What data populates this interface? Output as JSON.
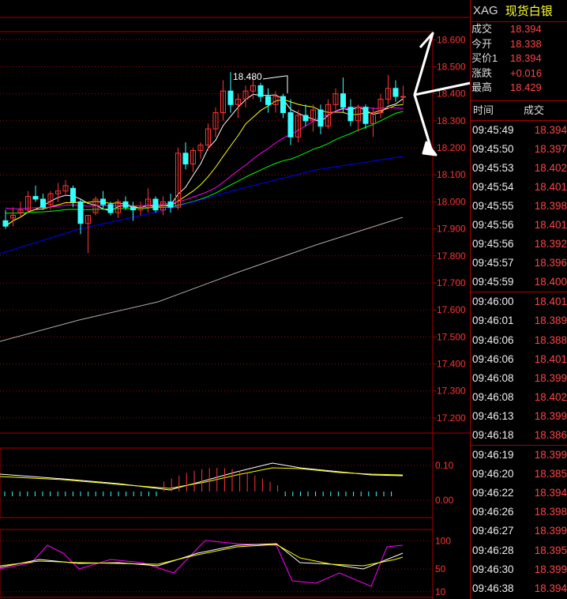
{
  "header": {
    "symbol": "XAG",
    "name": "现货白银"
  },
  "quote": [
    {
      "label": "成交",
      "value": "18.394"
    },
    {
      "label": "今开",
      "value": "18.338"
    },
    {
      "label": "买价1",
      "value": "18.394"
    },
    {
      "label": "涨跌",
      "value": "+0.016"
    },
    {
      "label": "最高",
      "value": "18.429"
    }
  ],
  "ticks_header": {
    "time": "时间",
    "price": "成交"
  },
  "ticks": [
    {
      "time": "09:45:49",
      "price": "18.394"
    },
    {
      "time": "09:45:50",
      "price": "18.397"
    },
    {
      "time": "09:45:53",
      "price": "18.402"
    },
    {
      "time": "09:45:54",
      "price": "18.401"
    },
    {
      "time": "09:45:55",
      "price": "18.398"
    },
    {
      "time": "09:45:56",
      "price": "18.401"
    },
    {
      "time": "09:45:56",
      "price": "18.392"
    },
    {
      "time": "09:45:57",
      "price": "18.396"
    },
    {
      "time": "09:45:59",
      "price": "18.400"
    },
    {
      "time": "09:46:00",
      "price": "18.401"
    },
    {
      "time": "09:46:01",
      "price": "18.389"
    },
    {
      "time": "09:46:06",
      "price": "18.388"
    },
    {
      "time": "09:46:06",
      "price": "18.401"
    },
    {
      "time": "09:46:08",
      "price": "18.399"
    },
    {
      "time": "09:46:08",
      "price": "18.402"
    },
    {
      "time": "09:46:13",
      "price": "18.399"
    },
    {
      "time": "09:46:18",
      "price": "18.386"
    },
    {
      "time": "09:46:19",
      "price": "18.399"
    },
    {
      "time": "09:46:20",
      "price": "18.385"
    },
    {
      "time": "09:46:22",
      "price": "18.394"
    },
    {
      "time": "09:46:26",
      "price": "18.398"
    },
    {
      "time": "09:46:27",
      "price": "18.399"
    },
    {
      "time": "09:46:28",
      "price": "18.395"
    },
    {
      "time": "09:46:30",
      "price": "18.399"
    },
    {
      "time": "09:46:38",
      "price": "18.394"
    }
  ],
  "colors": {
    "up": "#ff3333",
    "down": "#33ffff",
    "grid": "#aa0000",
    "ma5": "#ffffff",
    "ma10": "#ffff00",
    "ma20": "#ff00ff",
    "ma30": "#00ff00",
    "ma60": "#0000ff",
    "ma120": "#aaaaaa"
  },
  "chart_data": [
    {
      "type": "candlestick",
      "y_ticks": [
        "18.600",
        "18.500",
        "18.400",
        "18.300",
        "18.200",
        "18.100",
        "18.000",
        "17.900",
        "17.800",
        "17.700",
        "17.600",
        "17.500",
        "17.400",
        "17.300",
        "17.200"
      ],
      "ylim": [
        17.15,
        18.63
      ],
      "annotation": "18.480",
      "candles": [
        [
          17.93,
          17.97,
          17.9,
          17.91
        ],
        [
          17.94,
          17.98,
          17.91,
          17.95
        ],
        [
          17.96,
          18.0,
          17.94,
          17.97
        ],
        [
          17.97,
          18.04,
          17.96,
          18.02
        ],
        [
          18.02,
          18.06,
          18.0,
          18.01
        ],
        [
          18.01,
          18.03,
          17.97,
          17.98
        ],
        [
          17.99,
          18.04,
          17.97,
          18.03
        ],
        [
          18.03,
          18.07,
          18.0,
          18.04
        ],
        [
          18.04,
          18.08,
          18.02,
          18.06
        ],
        [
          18.05,
          18.06,
          17.98,
          18.0
        ],
        [
          18.0,
          18.01,
          17.88,
          17.92
        ],
        [
          17.92,
          17.95,
          17.81,
          17.95
        ],
        [
          17.96,
          18.02,
          17.95,
          18.01
        ],
        [
          18.01,
          18.04,
          17.97,
          17.99
        ],
        [
          17.99,
          18.0,
          17.95,
          17.96
        ],
        [
          17.96,
          18.01,
          17.94,
          18.0
        ],
        [
          18.0,
          18.02,
          17.97,
          17.98
        ],
        [
          17.98,
          18.0,
          17.93,
          17.97
        ],
        [
          17.97,
          18.0,
          17.95,
          17.98
        ],
        [
          17.98,
          18.05,
          17.96,
          18.01
        ],
        [
          18.01,
          18.02,
          17.96,
          17.97
        ],
        [
          17.97,
          18.02,
          17.95,
          18.0
        ],
        [
          18.0,
          18.03,
          17.96,
          17.98
        ],
        [
          17.98,
          18.2,
          17.97,
          18.18
        ],
        [
          18.18,
          18.22,
          18.12,
          18.14
        ],
        [
          18.14,
          18.2,
          18.11,
          18.19
        ],
        [
          18.19,
          18.22,
          18.16,
          18.21
        ],
        [
          18.21,
          18.29,
          18.19,
          18.27
        ],
        [
          18.27,
          18.35,
          18.24,
          18.33
        ],
        [
          18.33,
          18.45,
          18.3,
          18.41
        ],
        [
          18.41,
          18.48,
          18.33,
          18.36
        ],
        [
          18.36,
          18.4,
          18.31,
          18.38
        ],
        [
          18.38,
          18.43,
          18.35,
          18.41
        ],
        [
          18.41,
          18.46,
          18.38,
          18.43
        ],
        [
          18.43,
          18.44,
          18.37,
          18.39
        ],
        [
          18.39,
          18.42,
          18.33,
          18.36
        ],
        [
          18.36,
          18.41,
          18.33,
          18.39
        ],
        [
          18.39,
          18.4,
          18.31,
          18.33
        ],
        [
          18.33,
          18.38,
          18.21,
          18.24
        ],
        [
          18.24,
          18.34,
          18.22,
          18.32
        ],
        [
          18.32,
          18.36,
          18.28,
          18.3
        ],
        [
          18.3,
          18.36,
          18.26,
          18.34
        ],
        [
          18.34,
          18.36,
          18.25,
          18.28
        ],
        [
          18.28,
          18.38,
          18.27,
          18.36
        ],
        [
          18.36,
          18.42,
          18.34,
          18.4
        ],
        [
          18.4,
          18.46,
          18.33,
          18.35
        ],
        [
          18.35,
          18.38,
          18.28,
          18.3
        ],
        [
          18.3,
          18.36,
          18.26,
          18.35
        ],
        [
          18.35,
          18.36,
          18.27,
          18.29
        ],
        [
          18.29,
          18.35,
          18.24,
          18.33
        ],
        [
          18.33,
          18.4,
          18.31,
          18.38
        ],
        [
          18.38,
          18.47,
          18.36,
          18.42
        ],
        [
          18.42,
          18.45,
          18.37,
          18.39
        ],
        [
          18.39,
          18.43,
          18.36,
          18.39
        ]
      ]
    },
    {
      "type": "macd",
      "y_ticks": [
        "0.10",
        "0.00"
      ],
      "ylim": [
        -0.05,
        0.15
      ]
    },
    {
      "type": "kdj",
      "y_ticks": [
        "100",
        "50",
        "10"
      ],
      "ylim": [
        0,
        120
      ]
    }
  ]
}
